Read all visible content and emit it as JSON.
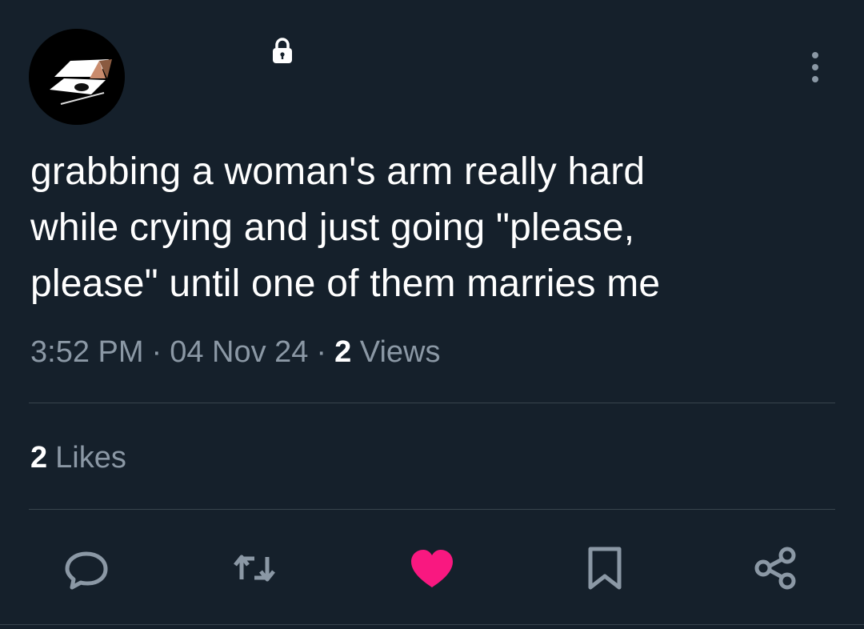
{
  "tweet": {
    "text": "grabbing a woman's arm really hard\nwhile crying and just going \"please,\nplease\" until one of them marries me",
    "time": "3:52 PM",
    "separator": "·",
    "date": "04 Nov 24",
    "views_count": "2",
    "views_label": "Views",
    "likes_count": "2",
    "likes_label": "Likes"
  },
  "icons": {
    "lock": "lock-icon",
    "more": "more-vertical-icon",
    "reply": "reply-icon",
    "retweet": "retweet-icon",
    "like": "heart-icon",
    "bookmark": "bookmark-icon",
    "share": "share-icon"
  },
  "colors": {
    "background": "#15202b",
    "text": "#ffffff",
    "secondary_text": "#8b98a5",
    "divider": "#38444d",
    "like_active": "#f91880"
  }
}
